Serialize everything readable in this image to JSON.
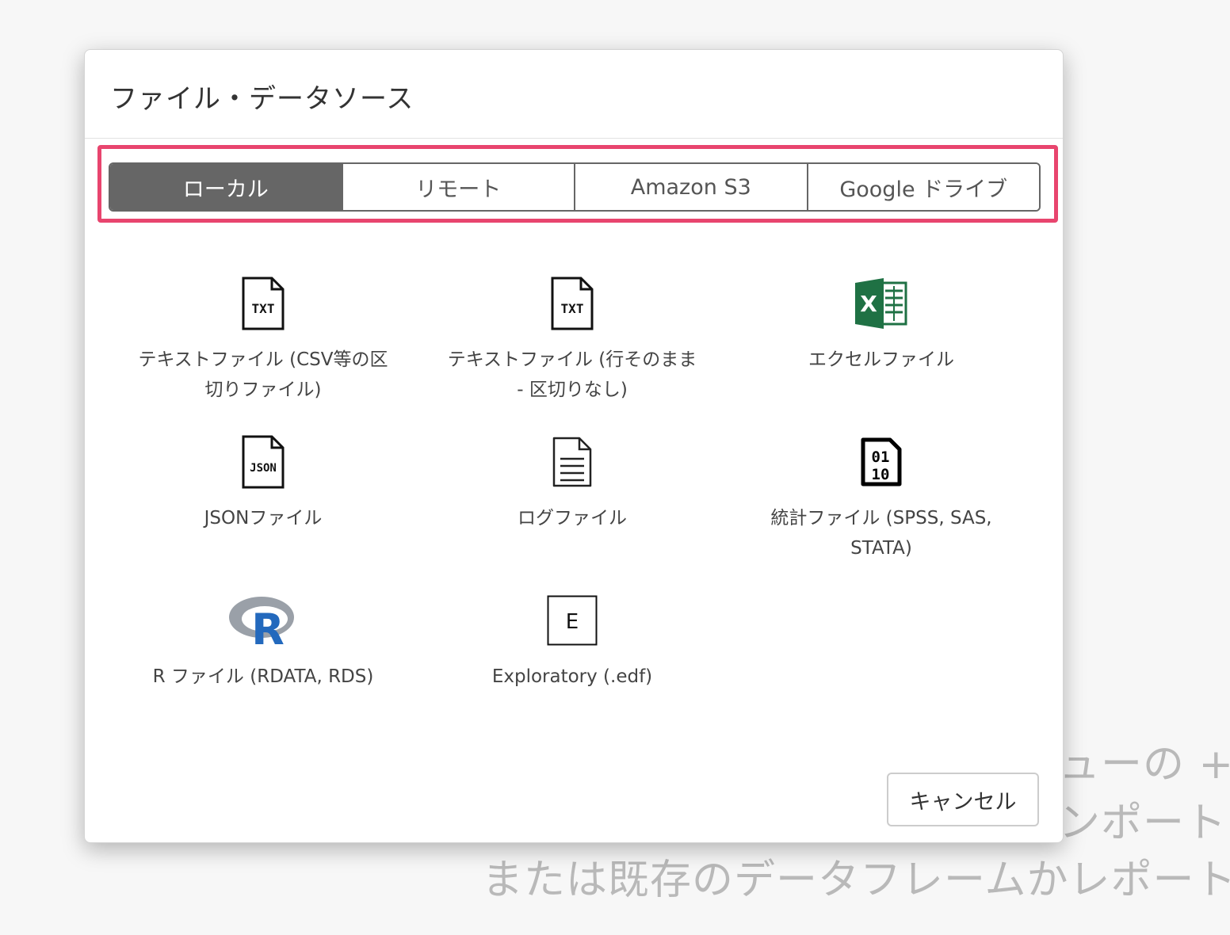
{
  "background": {
    "line1": "ューの + ボ",
    "line2": "ンポート",
    "line3": "または既存のデータフレームかレポート"
  },
  "modal": {
    "title": "ファイル・データソース",
    "tabs": [
      {
        "label": "ローカル",
        "active": true
      },
      {
        "label": "リモート",
        "active": false
      },
      {
        "label": "Amazon S3",
        "active": false
      },
      {
        "label": "Google ドライブ",
        "active": false
      }
    ],
    "items": [
      {
        "label": "テキストファイル (CSV等の区切りファイル)",
        "icon": "txt-file-icon",
        "icon_text": "TXT"
      },
      {
        "label": "テキストファイル (行そのまま - 区切りなし)",
        "icon": "txt-file-icon",
        "icon_text": "TXT"
      },
      {
        "label": "エクセルファイル",
        "icon": "excel-icon",
        "icon_text": "X"
      },
      {
        "label": "JSONファイル",
        "icon": "json-file-icon",
        "icon_text": "JSON"
      },
      {
        "label": "ログファイル",
        "icon": "log-file-icon",
        "icon_text": ""
      },
      {
        "label": "統計ファイル (SPSS, SAS, STATA)",
        "icon": "binary-file-icon",
        "icon_text": "01 10"
      },
      {
        "label": "R ファイル (RDATA, RDS)",
        "icon": "r-logo-icon",
        "icon_text": "R"
      },
      {
        "label": "Exploratory (.edf)",
        "icon": "exploratory-icon",
        "icon_text": "E"
      }
    ],
    "cancel_label": "キャンセル"
  },
  "colors": {
    "highlight": "#e8456e",
    "tab_active_bg": "#666666",
    "excel_green": "#1f7144",
    "r_blue": "#2369bd"
  }
}
